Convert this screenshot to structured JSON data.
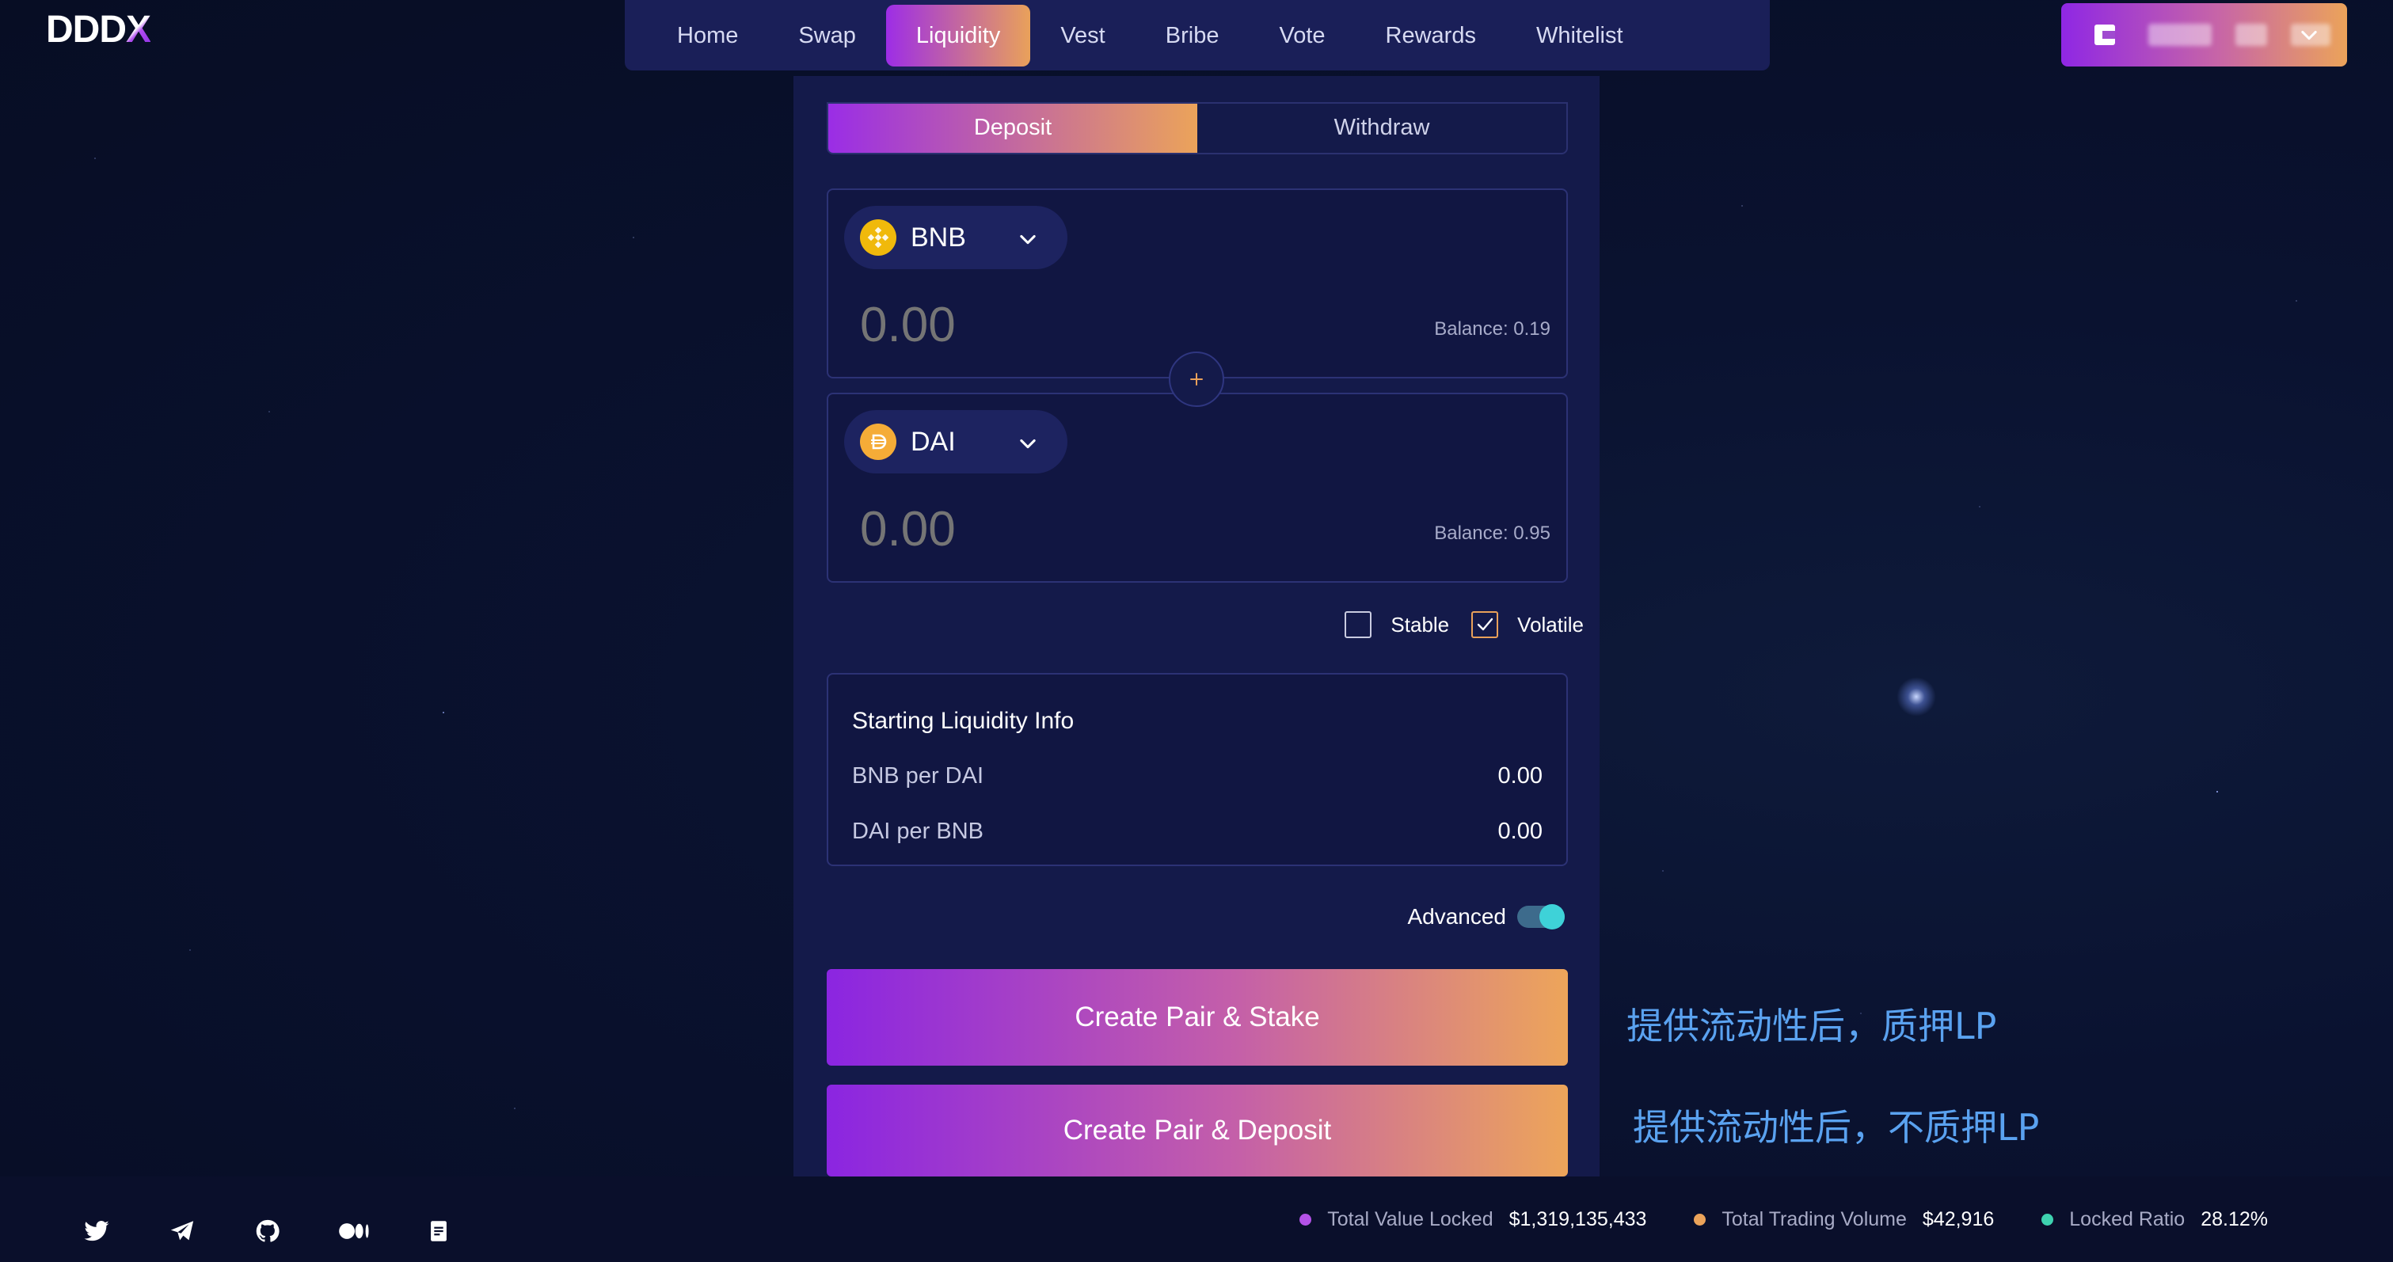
{
  "brand": {
    "logo_text": "DDD",
    "logo_x": "X"
  },
  "nav": {
    "items": [
      {
        "label": "Home",
        "active": false
      },
      {
        "label": "Swap",
        "active": false
      },
      {
        "label": "Liquidity",
        "active": true
      },
      {
        "label": "Vest",
        "active": false
      },
      {
        "label": "Bribe",
        "active": false
      },
      {
        "label": "Vote",
        "active": false
      },
      {
        "label": "Rewards",
        "active": false
      },
      {
        "label": "Whitelist",
        "active": false
      }
    ]
  },
  "wallet": {
    "icon": "wallet-icon",
    "address_blurred": true,
    "chevron": "chevron-down-icon"
  },
  "tabs": {
    "deposit": "Deposit",
    "withdraw": "Withdraw",
    "active": "deposit"
  },
  "token1": {
    "symbol": "BNB",
    "icon": "bnb-icon",
    "amount_placeholder": "0.00",
    "balance": "Balance: 0.19"
  },
  "token2": {
    "symbol": "DAI",
    "icon": "dai-icon",
    "amount_placeholder": "0.00",
    "balance": "Balance: 0.95"
  },
  "plus_icon": "plus-icon",
  "pool_type": {
    "stable_label": "Stable",
    "stable_checked": false,
    "volatile_label": "Volatile",
    "volatile_checked": true
  },
  "liquidity_info": {
    "title": "Starting Liquidity Info",
    "rows": [
      {
        "label": "BNB per DAI",
        "value": "0.00"
      },
      {
        "label": "DAI per BNB",
        "value": "0.00"
      }
    ]
  },
  "advanced": {
    "label": "Advanced",
    "enabled": true
  },
  "actions": {
    "stake_label": "Create Pair & Stake",
    "deposit_label": "Create Pair & Deposit"
  },
  "annotations": {
    "stake_note": "提供流动性后，质押LP",
    "deposit_note": "提供流动性后，不质押LP"
  },
  "footer": {
    "social_icons": [
      "twitter-icon",
      "telegram-icon",
      "github-icon",
      "medium-icon",
      "docs-icon"
    ],
    "stats": [
      {
        "label": "Total Value Locked",
        "value": "$1,319,135,433",
        "color": "#b452e8"
      },
      {
        "label": "Total Trading Volume",
        "value": "$42,916",
        "color": "#eba35a"
      },
      {
        "label": "Locked Ratio",
        "value": "28.12%",
        "color": "#3ed2b0"
      }
    ]
  },
  "colors": {
    "accent_start": "#8b25e1",
    "accent_end": "#eda55a",
    "card_bg": "#141a4a",
    "annotation": "#5aa2f0"
  }
}
